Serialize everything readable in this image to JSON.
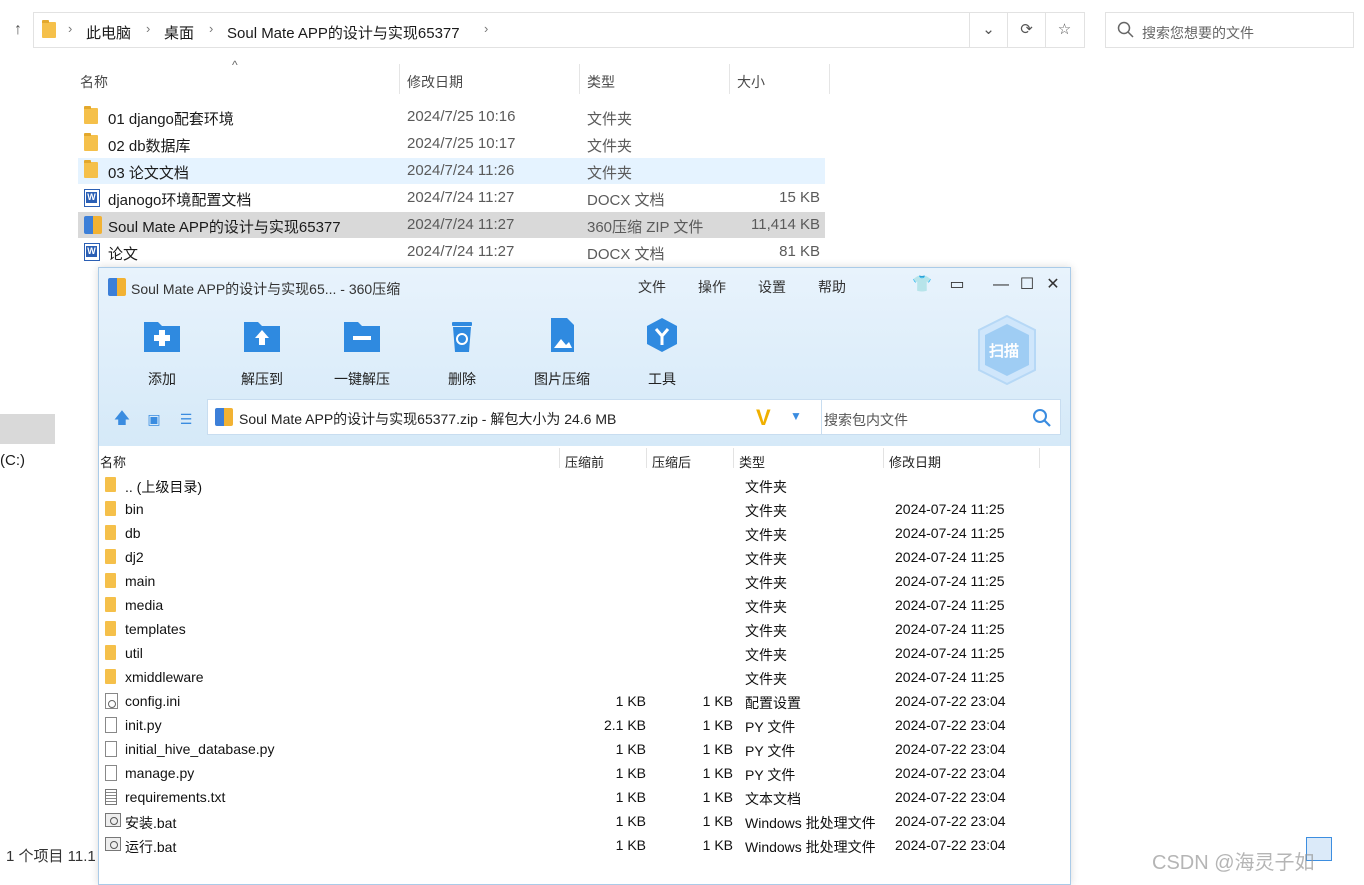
{
  "explorer": {
    "breadcrumb": [
      "此电脑",
      "桌面",
      "Soul Mate APP的设计与实现65377"
    ],
    "search_placeholder": "搜索您想要的文件",
    "columns": {
      "name": "名称",
      "modified": "修改日期",
      "type": "类型",
      "size": "大小"
    },
    "files": [
      {
        "name": "01 django配套环境",
        "modified": "2024/7/25 10:16",
        "type": "文件夹",
        "size": "",
        "icon": "folder-icon"
      },
      {
        "name": "02 db数据库",
        "modified": "2024/7/25 10:17",
        "type": "文件夹",
        "size": "",
        "icon": "folder-icon"
      },
      {
        "name": "03 论文文档",
        "modified": "2024/7/24 11:26",
        "type": "文件夹",
        "size": "",
        "icon": "folder-icon"
      },
      {
        "name": "djanogo环境配置文档",
        "modified": "2024/7/24 11:27",
        "type": "DOCX 文档",
        "size": "15 KB",
        "icon": "word-doc-icon"
      },
      {
        "name": "Soul Mate APP的设计与实现65377",
        "modified": "2024/7/24 11:27",
        "type": "360压缩 ZIP 文件",
        "size": "11,414 KB",
        "icon": "zip-archive-icon"
      },
      {
        "name": "论文",
        "modified": "2024/7/24 11:27",
        "type": "DOCX 文档",
        "size": "81 KB",
        "icon": "word-doc-icon"
      }
    ],
    "leftpane_drive": "(C:)",
    "status_text": "1 个项目   11.1",
    "watermark": "CSDN @海灵子如"
  },
  "zip": {
    "title": "Soul Mate APP的设计与实现65... - 360压缩",
    "menu": [
      "文件",
      "操作",
      "设置",
      "帮助"
    ],
    "tools": [
      "添加",
      "解压到",
      "一键解压",
      "删除",
      "图片压缩",
      "工具"
    ],
    "scan_label": "扫描",
    "path_text": "Soul Mate APP的设计与实现65377.zip - 解包大小为 24.6 MB",
    "search_placeholder": "搜索包内文件",
    "columns": {
      "name": "名称",
      "before": "压缩前",
      "after": "压缩后",
      "type": "类型",
      "modified": "修改日期"
    },
    "entries": [
      {
        "name": ".. (上级目录)",
        "before": "",
        "after": "",
        "type": "文件夹",
        "modified": "",
        "icon": "folder-icon"
      },
      {
        "name": "bin",
        "before": "",
        "after": "",
        "type": "文件夹",
        "modified": "2024-07-24 11:25",
        "icon": "folder-icon"
      },
      {
        "name": "db",
        "before": "",
        "after": "",
        "type": "文件夹",
        "modified": "2024-07-24 11:25",
        "icon": "folder-icon"
      },
      {
        "name": "dj2",
        "before": "",
        "after": "",
        "type": "文件夹",
        "modified": "2024-07-24 11:25",
        "icon": "folder-icon"
      },
      {
        "name": "main",
        "before": "",
        "after": "",
        "type": "文件夹",
        "modified": "2024-07-24 11:25",
        "icon": "folder-icon"
      },
      {
        "name": "media",
        "before": "",
        "after": "",
        "type": "文件夹",
        "modified": "2024-07-24 11:25",
        "icon": "folder-icon"
      },
      {
        "name": "templates",
        "before": "",
        "after": "",
        "type": "文件夹",
        "modified": "2024-07-24 11:25",
        "icon": "folder-icon"
      },
      {
        "name": "util",
        "before": "",
        "after": "",
        "type": "文件夹",
        "modified": "2024-07-24 11:25",
        "icon": "folder-icon"
      },
      {
        "name": "xmiddleware",
        "before": "",
        "after": "",
        "type": "文件夹",
        "modified": "2024-07-24 11:25",
        "icon": "folder-icon"
      },
      {
        "name": "config.ini",
        "before": "1 KB",
        "after": "1 KB",
        "type": "配置设置",
        "modified": "2024-07-22 23:04",
        "icon": "settings-file-icon"
      },
      {
        "name": "init.py",
        "before": "2.1 KB",
        "after": "1 KB",
        "type": "PY 文件",
        "modified": "2024-07-22 23:04",
        "icon": "file-icon"
      },
      {
        "name": "initial_hive_database.py",
        "before": "1 KB",
        "after": "1 KB",
        "type": "PY 文件",
        "modified": "2024-07-22 23:04",
        "icon": "file-icon"
      },
      {
        "name": "manage.py",
        "before": "1 KB",
        "after": "1 KB",
        "type": "PY 文件",
        "modified": "2024-07-22 23:04",
        "icon": "file-icon"
      },
      {
        "name": "requirements.txt",
        "before": "1 KB",
        "after": "1 KB",
        "type": "文本文档",
        "modified": "2024-07-22 23:04",
        "icon": "text-file-icon"
      },
      {
        "name": "安装.bat",
        "before": "1 KB",
        "after": "1 KB",
        "type": "Windows 批处理文件",
        "modified": "2024-07-22 23:04",
        "icon": "batch-file-icon"
      },
      {
        "name": "运行.bat",
        "before": "1 KB",
        "after": "1 KB",
        "type": "Windows 批处理文件",
        "modified": "2024-07-22 23:04",
        "icon": "batch-file-icon"
      }
    ]
  }
}
